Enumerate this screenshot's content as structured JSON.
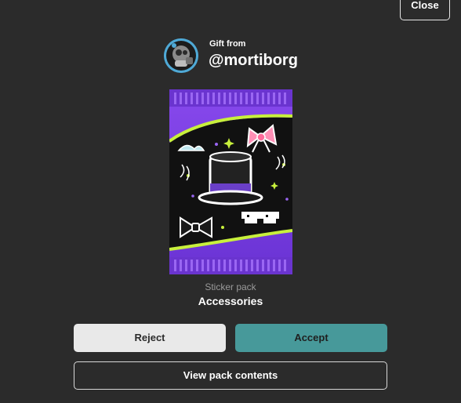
{
  "header": {
    "close_label": "Close"
  },
  "gift": {
    "from_label": "Gift from",
    "username": "@mortiborg"
  },
  "pack": {
    "type_label": "Sticker pack",
    "name": "Accessories"
  },
  "actions": {
    "reject_label": "Reject",
    "accept_label": "Accept",
    "view_contents_label": "View pack contents"
  },
  "colors": {
    "background": "#2b2b2b",
    "accept": "#47999a",
    "reject": "#e9e9e9",
    "pack_purple": "#7a3fe0",
    "pack_accent": "#c8f03c"
  }
}
